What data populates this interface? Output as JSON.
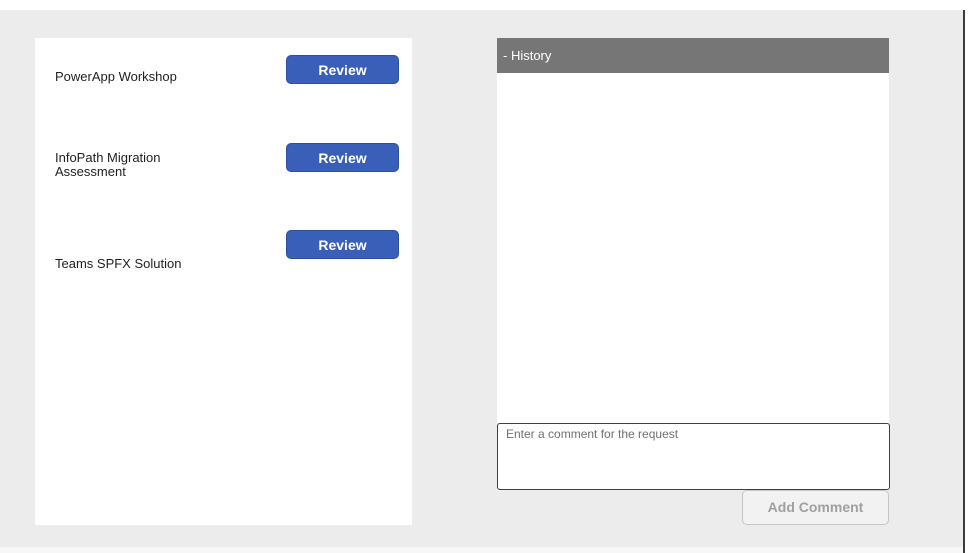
{
  "gallery": {
    "items": [
      {
        "title": "PowerApp Workshop",
        "button_label": "Review"
      },
      {
        "title": "InfoPath Migration Assessment",
        "button_label": "Review"
      },
      {
        "title": "Teams SPFX Solution",
        "button_label": "Review"
      }
    ]
  },
  "history": {
    "header": "- History"
  },
  "comment": {
    "value": "",
    "placeholder": "Enter a comment for the request"
  },
  "add_comment": {
    "label": "Add Comment"
  },
  "colors": {
    "primary_button": "#3a5fb8",
    "history_header": "#767676",
    "app_background": "#ececec",
    "comment_border": "#2f3f72",
    "disabled_text": "#a0a0a0"
  }
}
